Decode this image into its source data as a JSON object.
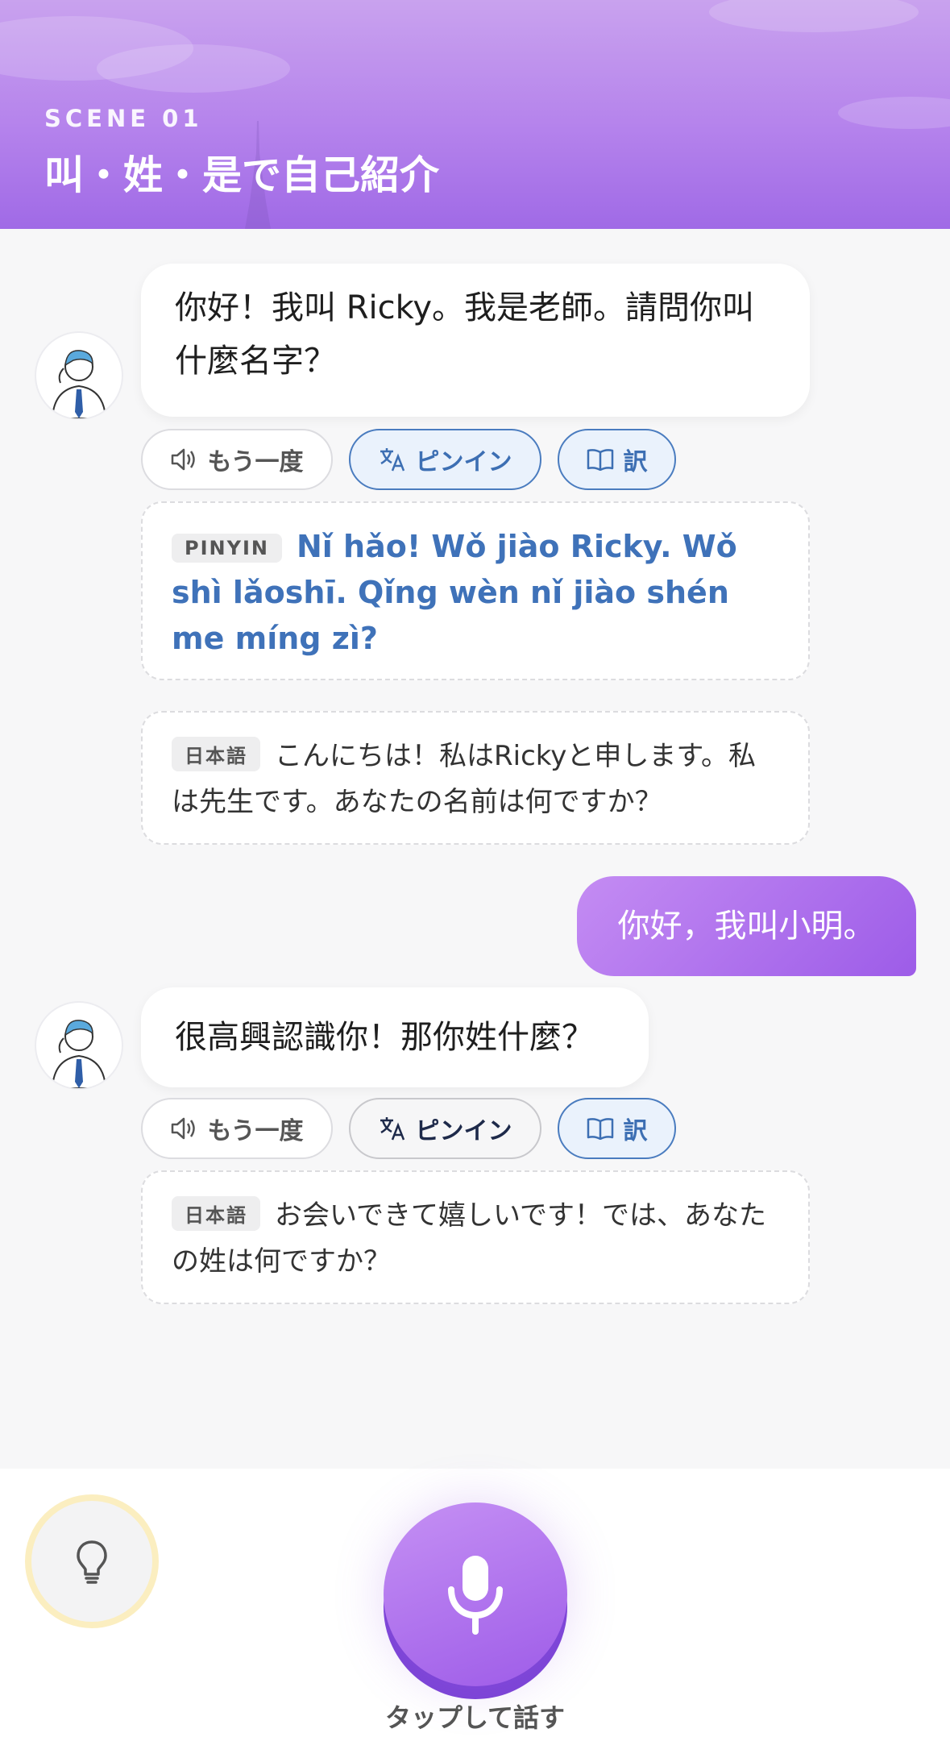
{
  "header": {
    "scene_label": "SCENE 01",
    "title": "叫・姓・是で自己紹介"
  },
  "messages": [
    {
      "role": "bot",
      "text": "你好！我叫 Ricky。我是老師。請問你叫什麼名字？",
      "actions": {
        "replay": "もう一度",
        "pinyin": "ピンイン",
        "translate": "訳"
      },
      "pinyin_tag": "PINYIN",
      "pinyin": "Nǐ hǎo! Wǒ jiào Ricky. Wǒ shì lǎoshī. Qǐng wèn nǐ jiào shén me míng zì?",
      "japanese_tag": "日本語",
      "japanese": "こんにちは！私はRickyと申します。私は先生です。あなたの名前は何ですか？"
    },
    {
      "role": "user",
      "text": "你好，我叫小明。"
    },
    {
      "role": "bot",
      "text": "很高興認識你！那你姓什麼？",
      "actions": {
        "replay": "もう一度",
        "pinyin": "ピンイン",
        "translate": "訳"
      },
      "japanese_tag": "日本語",
      "japanese": "お会いできて嬉しいです！では、あなたの姓は何ですか？"
    }
  ],
  "bottom_bar": {
    "hint_icon": "lightbulb-icon",
    "mic_icon": "microphone-icon",
    "mic_label": "タップして話す"
  },
  "colors": {
    "header_top": "#c9a2ee",
    "header_bottom": "#a06ae6",
    "pinyin_blue": "#3f72b9",
    "user_bubble": "#9d5ce8",
    "hint_ring": "#fbeec0"
  }
}
